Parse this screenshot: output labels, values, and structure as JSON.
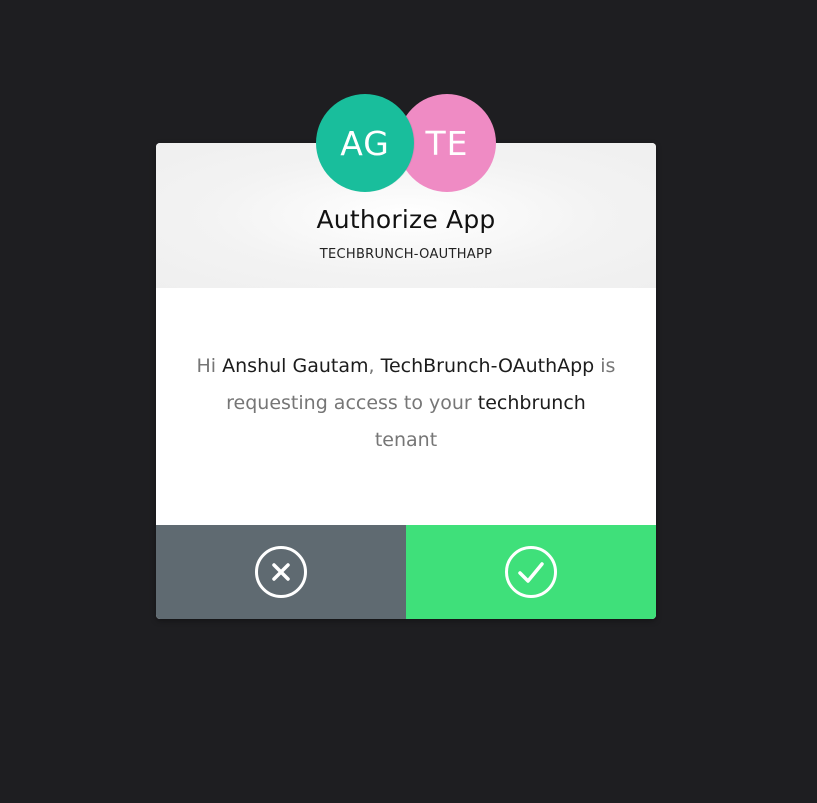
{
  "avatars": {
    "user": {
      "initials": "AG",
      "color": "#19be9c"
    },
    "tenant": {
      "initials": "TE",
      "color": "#ef8bc4"
    }
  },
  "header": {
    "title": "Authorize App",
    "app_name": "TECHBRUNCH-OAUTHAPP"
  },
  "message": {
    "greeting": "Hi",
    "user_name": "Anshul Gautam",
    "separator": ",",
    "app_display_name": "TechBrunch-OAuthApp",
    "request_text": "is requesting access to your",
    "tenant_name": "techbrunch",
    "tenant_suffix": "tenant"
  },
  "actions": {
    "deny": {
      "icon": "close-circle-icon",
      "color": "#5f6a71"
    },
    "accept": {
      "icon": "check-circle-icon",
      "color": "#3fe07a"
    }
  },
  "colors": {
    "background": "#1e1e21",
    "card_header": "#f1f1f1"
  }
}
